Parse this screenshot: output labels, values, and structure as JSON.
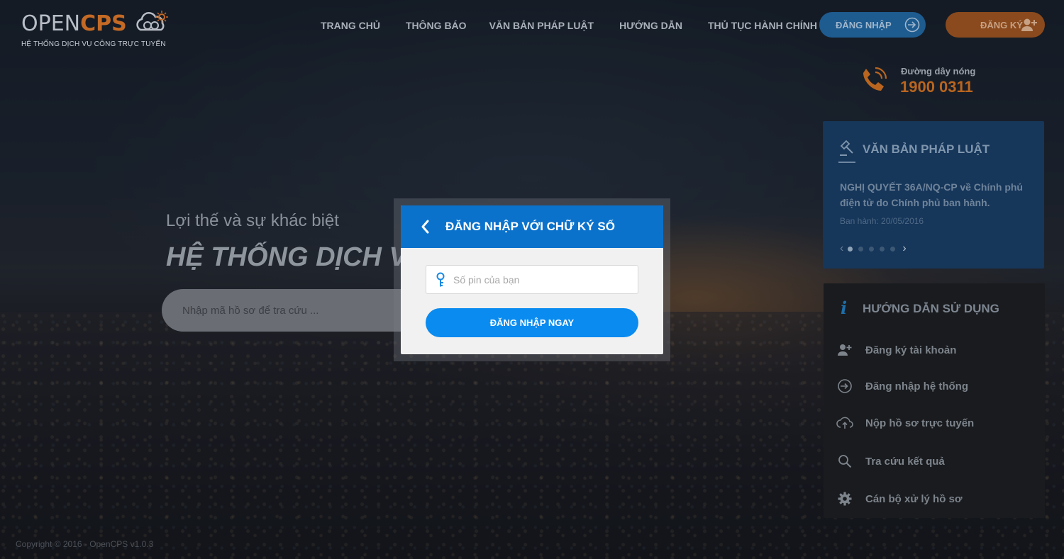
{
  "header": {
    "logo_open": "OPEN",
    "logo_cps": "CPS",
    "logo_subtitle": "HỆ THỐNG DỊCH VỤ CÔNG TRỰC TUYẾN",
    "nav": [
      "TRANG CHỦ",
      "THÔNG BÁO",
      "VĂN BẢN PHÁP LUẬT",
      "HƯỚNG DẪN",
      "THỦ TỤC HÀNH CHÍNH"
    ],
    "login_label": "ĐĂNG NHẬP",
    "register_label": "ĐĂNG KÝ"
  },
  "hotline": {
    "label": "Đường dây nóng",
    "number": "1900 0311"
  },
  "hero": {
    "subtitle": "Lợi thế và sự khác biệt",
    "title": "HỆ THỐNG DỊCH VỤ",
    "search_placeholder": "Nhập mã hồ sơ để tra cứu ..."
  },
  "legal_docs": {
    "title": "VĂN BẢN PHÁP LUẬT",
    "doc_text": "NGHỊ QUYẾT 36A/NQ-CP về Chính phủ điện tử do Chính phủ ban hành.",
    "date": "Ban hành: 20/05/2016",
    "active_slide": 1,
    "slide_count": 5
  },
  "guide": {
    "title": "HƯỚNG DẪN SỬ DỤNG",
    "items": [
      {
        "label": "Đăng ký tài khoản",
        "icon": "add-user-icon"
      },
      {
        "label": "Đăng nhập hệ thống",
        "icon": "login-icon"
      },
      {
        "label": "Nộp hồ sơ trực tuyến",
        "icon": "cloud-upload-icon"
      },
      {
        "label": "Tra cứu kết quả",
        "icon": "search-icon"
      },
      {
        "label": "Cán bộ xử lý hồ sơ",
        "icon": "gear-icon"
      }
    ]
  },
  "footer": {
    "copyright": "Copyright © 2016 - OpenCPS v1.0.3"
  },
  "modal": {
    "title": "ĐĂNG NHẬP VỚI CHỮ KÝ SỐ",
    "pin_placeholder": "Số pin của bạn",
    "pin_value": "",
    "submit_label": "ĐĂNG NHẬP NGAY"
  },
  "colors": {
    "primary_blue": "#0b72cc",
    "button_blue": "#0a8bf0",
    "brand_orange": "#c46a25"
  }
}
